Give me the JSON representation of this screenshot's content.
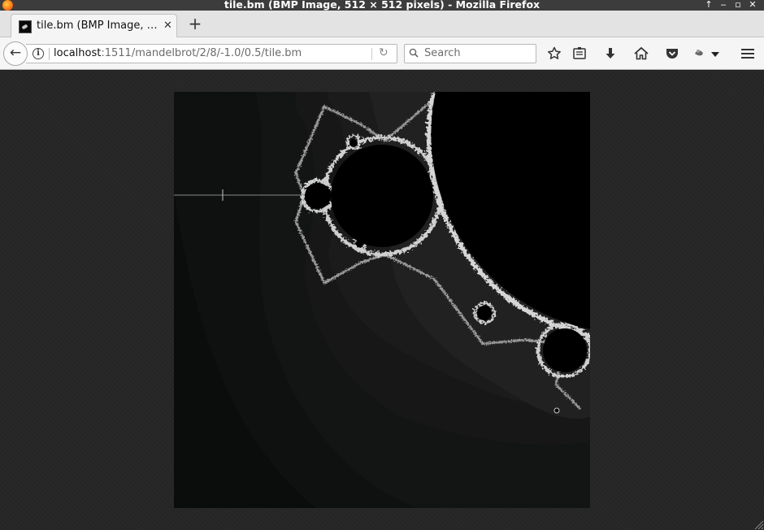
{
  "window": {
    "title": "tile.bm (BMP Image, 512 × 512 pixels) - Mozilla Firefox",
    "controls": {
      "up": "↑",
      "minimize": "‒",
      "maximize": "▫",
      "close": "✕"
    }
  },
  "tabs": [
    {
      "label": "tile.bm (BMP Image, …",
      "close": "✕",
      "active": true
    }
  ],
  "new_tab_label": "+",
  "navbar": {
    "back_label": "←",
    "info_label": "i",
    "url_host": "localhost",
    "url_path": ":1511/mandelbrot/2/8/-1.0/0.5/tile.bm",
    "reload_label": "↻",
    "search_placeholder": "Search"
  },
  "toolbar_icons": [
    "star-icon",
    "reading-list-icon",
    "download-icon",
    "home-icon",
    "pocket-icon",
    "extension-icon",
    "menu-icon"
  ],
  "image": {
    "description_icon": "mandelbrot-fractal-tile",
    "background_color": "#0a0d0b",
    "bands": [
      "#0d100e",
      "#141614",
      "#191919",
      "#1e1e1e",
      "#232323"
    ]
  }
}
